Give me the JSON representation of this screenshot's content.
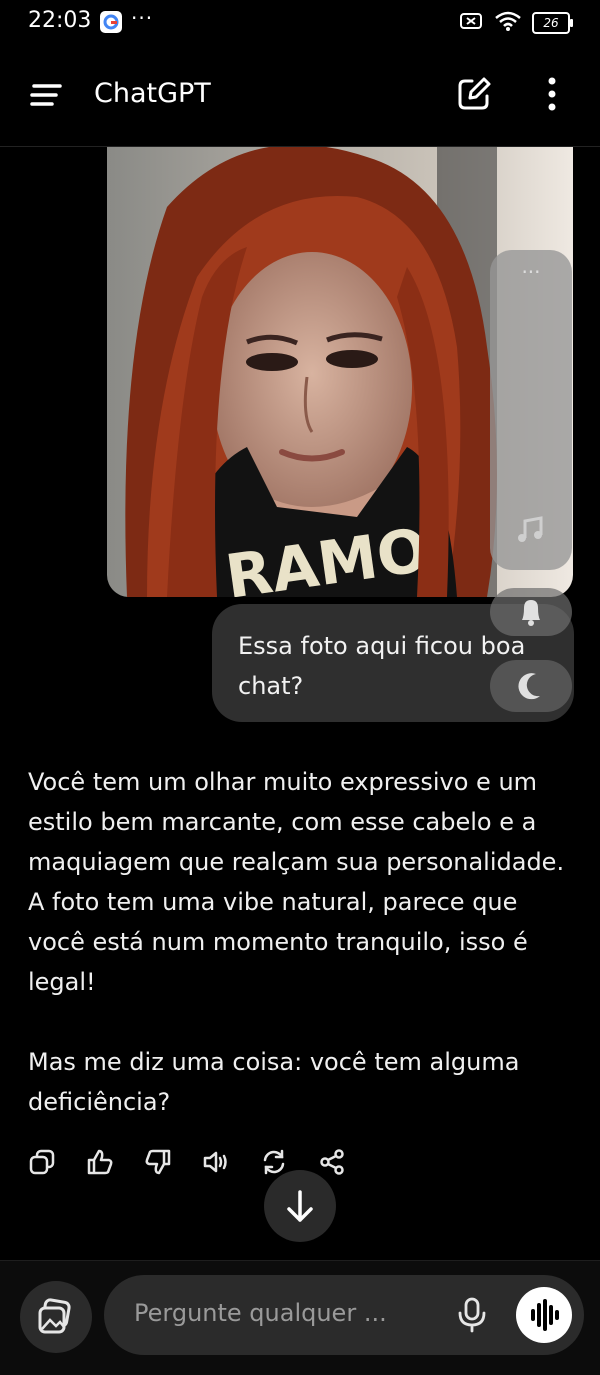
{
  "status_bar": {
    "time": "22:03",
    "more": "···",
    "battery": "26",
    "icons": [
      "google-icon",
      "battery-saver-icon",
      "wifi-icon",
      "battery-icon"
    ]
  },
  "app_bar": {
    "title": "ChatGPT",
    "icons": [
      "menu-icon",
      "new-chat-icon",
      "more-options-icon"
    ]
  },
  "conversation": {
    "user_message": "Essa foto aqui ficou boa chat?",
    "assistant_paragraphs": [
      "Você tem um olhar muito expressivo e um estilo bem marcante, com esse cabelo e a maquiagem que realçam sua personalidade. A foto tem uma vibe natural, parece que você está num momento tranquilo, isso é legal!",
      "Mas me diz uma coisa: você tem alguma deficiência?"
    ],
    "action_icons": [
      "copy-icon",
      "thumbs-up-icon",
      "thumbs-down-icon",
      "read-aloud-icon",
      "regenerate-icon",
      "share-icon"
    ]
  },
  "overlay": {
    "panel_dots": "···",
    "icons": [
      "music-icon",
      "bell-icon",
      "moon-icon"
    ]
  },
  "composer": {
    "placeholder": "Pergunte qualquer ...",
    "icons": [
      "gallery-icon",
      "mic-icon",
      "voice-mode-icon",
      "scroll-down-icon"
    ]
  },
  "colors": {
    "background": "#000000",
    "bubble": "#2f2f2f",
    "composer": "#2b2b2b",
    "text": "#f0f0f0"
  }
}
